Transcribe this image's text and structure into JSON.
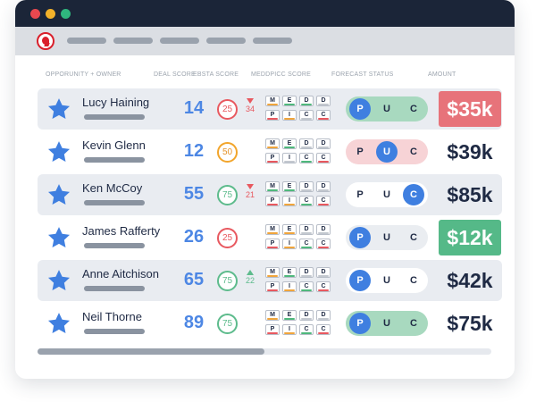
{
  "columns": {
    "opportunity": "OPPORUNITY + OWNER",
    "deal_score": "DEAL SCORE",
    "ebsta_score": "EBSTA SCORE",
    "meddpicc": "MEDDPICC SCORE",
    "forecast": "FORECAST STATUS",
    "amount": "AMOUNT"
  },
  "meddpicc_letters": {
    "top": [
      "M",
      "E",
      "D",
      "D"
    ],
    "bottom": [
      "P",
      "I",
      "C",
      "C"
    ]
  },
  "forecast_letters": [
    "P",
    "U",
    "C"
  ],
  "status_colors": {
    "bad": "#e7737a",
    "good": "#55b988",
    "accent": "#3f7fe0"
  },
  "rows": [
    {
      "name": "Lucy Haining",
      "deal_score": "14",
      "ebsta_score": "25",
      "ebsta_color": "red",
      "trend": "down",
      "trend_value": "34",
      "forecast_active": "P",
      "forecast_bg": "#a8d9bf",
      "amount": "$35k",
      "amount_status": "bad",
      "meddpicc_colors": [
        "orange",
        "green",
        "green",
        "grey",
        "red",
        "orange",
        "grey",
        "red"
      ]
    },
    {
      "name": "Kevin Glenn",
      "deal_score": "12",
      "ebsta_score": "50",
      "ebsta_color": "orange",
      "trend": "",
      "trend_value": "",
      "forecast_active": "U",
      "forecast_bg": "#f7d3d6",
      "amount": "$39k",
      "amount_status": "",
      "meddpicc_colors": [
        "orange",
        "green",
        "grey",
        "grey",
        "red",
        "grey",
        "green",
        "red"
      ]
    },
    {
      "name": "Ken McCoy",
      "deal_score": "55",
      "ebsta_score": "75",
      "ebsta_color": "green",
      "trend": "down",
      "trend_value": "21",
      "forecast_active": "C",
      "forecast_bg": "#ffffff",
      "amount": "$85k",
      "amount_status": "",
      "meddpicc_colors": [
        "green",
        "green",
        "grey",
        "grey",
        "red",
        "orange",
        "green",
        "red"
      ]
    },
    {
      "name": "James Rafferty",
      "deal_score": "26",
      "ebsta_score": "25",
      "ebsta_color": "red",
      "trend": "",
      "trend_value": "",
      "forecast_active": "P",
      "forecast_bg": "#eaedf1",
      "amount": "$12k",
      "amount_status": "good",
      "meddpicc_colors": [
        "orange",
        "orange",
        "grey",
        "grey",
        "red",
        "orange",
        "green",
        "red"
      ]
    },
    {
      "name": "Anne Aitchison",
      "deal_score": "65",
      "ebsta_score": "75",
      "ebsta_color": "green",
      "trend": "up",
      "trend_value": "22",
      "forecast_active": "P",
      "forecast_bg": "#ffffff",
      "amount": "$42k",
      "amount_status": "",
      "meddpicc_colors": [
        "orange",
        "green",
        "grey",
        "grey",
        "red",
        "orange",
        "green",
        "red"
      ]
    },
    {
      "name": "Neil Thorne",
      "deal_score": "89",
      "ebsta_score": "75",
      "ebsta_color": "green",
      "trend": "",
      "trend_value": "",
      "forecast_active": "P",
      "forecast_bg": "#a8d9bf",
      "amount": "$75k",
      "amount_status": "",
      "meddpicc_colors": [
        "orange",
        "green",
        "grey",
        "grey",
        "red",
        "orange",
        "green",
        "red"
      ]
    }
  ],
  "scrollbar": {
    "thumb_fraction": 0.5
  }
}
